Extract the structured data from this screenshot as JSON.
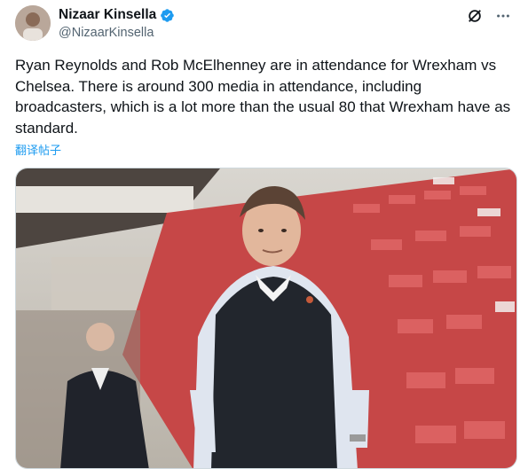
{
  "author": {
    "name": "Nizaar Kinsella",
    "handle": "@NizaarKinsella",
    "avatar_icon": "avatar-photo",
    "verified_color": "#1d9bf0"
  },
  "icons": {
    "grok": "grok-icon",
    "more": "more-options-icon"
  },
  "tweet": {
    "text": "Ryan Reynolds and Rob McElhenney are in attendance for Wrexham vs Chelsea. There is around 300 media in attendance, including broadcasters, which is a lot more than the usual 80 that Wrexham have as standard.",
    "translate_label": "翻译帖子"
  },
  "media": {
    "description": "photo",
    "accent_color": "#d23a3a"
  }
}
